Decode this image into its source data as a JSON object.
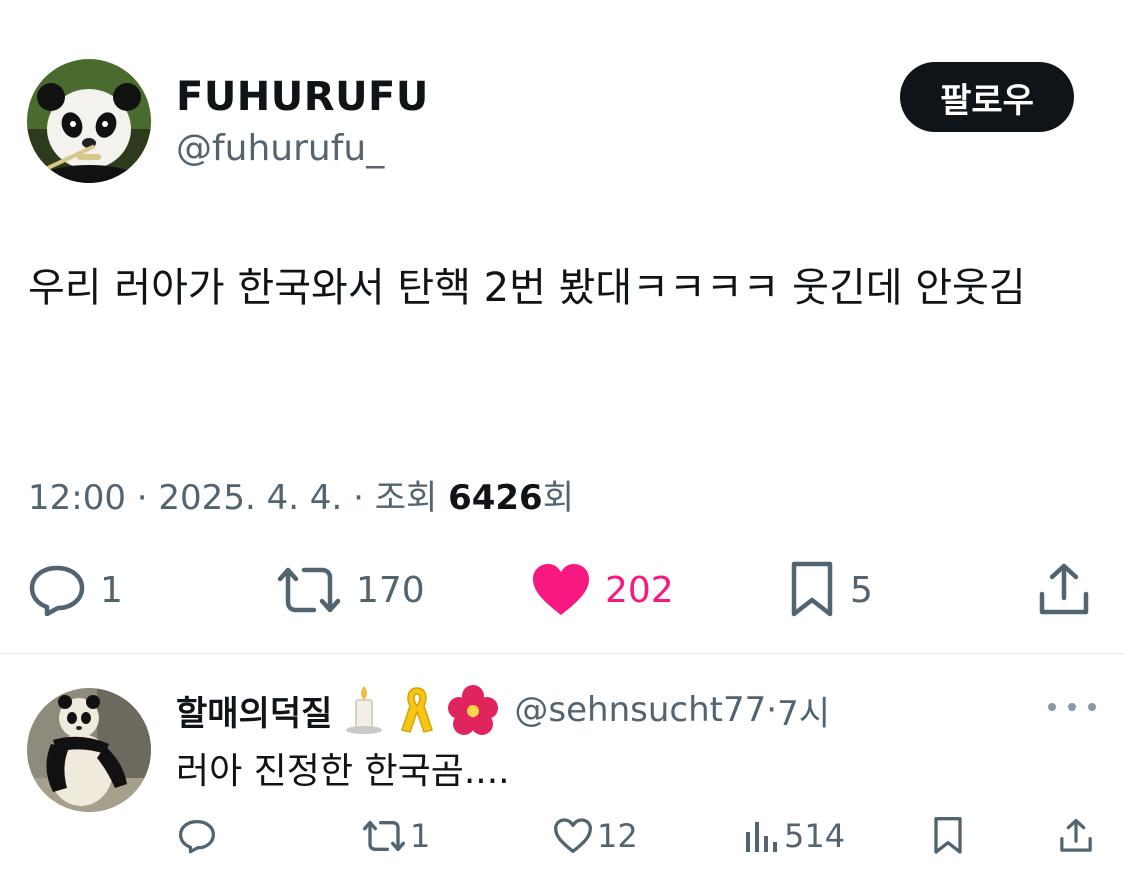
{
  "tweet": {
    "author_name": "FUHURUFU",
    "author_handle": "@fuhurufu_",
    "follow_label": "팔로우",
    "text": "우리 러아가 한국와서 탄핵 2번 봤대ㅋㅋㅋㅋ 웃긴데 안웃김",
    "time": "12:00",
    "date": "2025. 4. 4.",
    "views_label": "조회",
    "views_count": "6426",
    "views_suffix": "회",
    "separator": " · ",
    "actions": {
      "reply_count": "1",
      "retweet_count": "170",
      "like_count": "202",
      "bookmark_count": "5"
    }
  },
  "reply": {
    "author_name": "할매의덕질",
    "author_handle": "@sehnsucht77",
    "time": "7시",
    "separator": " · ",
    "text": "러아 진정한 한국곰....",
    "actions": {
      "reply_count": "",
      "retweet_count": "1",
      "like_count": "12",
      "views_count": "514"
    }
  },
  "colors": {
    "text_primary": "#0f1419",
    "text_secondary": "#536471",
    "like_pink": "#f91880",
    "divider": "#e1e6ea"
  },
  "icons": [
    "reply-icon",
    "retweet-icon",
    "heart-filled-icon",
    "bookmark-icon",
    "share-icon",
    "heart-outline-icon",
    "views-bar-icon",
    "more-dots-icon",
    "candle-emoji-icon",
    "yellow-ribbon-emoji-icon",
    "hibiscus-emoji-icon"
  ]
}
